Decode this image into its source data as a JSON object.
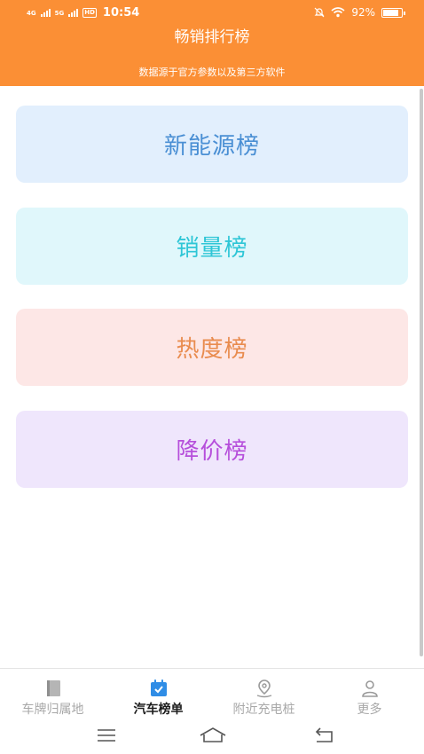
{
  "status_bar": {
    "net1": "4G",
    "net2": "5G",
    "hd": "HD",
    "time": "10:54",
    "battery_text": "92%",
    "battery_level": 0.92
  },
  "header": {
    "title": "畅销排行榜",
    "subtitle": "数据源于官方参数以及第三方软件",
    "bg_color": "#fb8f35"
  },
  "cards": [
    {
      "label": "新能源榜",
      "bg": "#e2effd",
      "color": "#4a8fd4"
    },
    {
      "label": "销量榜",
      "bg": "#e0f7fb",
      "color": "#2ec6d6"
    },
    {
      "label": "热度榜",
      "bg": "#fde7e6",
      "color": "#e98c4f"
    },
    {
      "label": "降价榜",
      "bg": "#efe6fc",
      "color": "#b64fdb"
    }
  ],
  "tabbar": {
    "tabs": [
      {
        "label": "车牌归属地",
        "icon": "book-icon",
        "active": false
      },
      {
        "label": "汽车榜单",
        "icon": "calendar-check-icon",
        "active": true
      },
      {
        "label": "附近充电桩",
        "icon": "location-pin-icon",
        "active": false
      },
      {
        "label": "更多",
        "icon": "user-icon",
        "active": false
      }
    ],
    "active_color": "#2f8de6"
  },
  "navbar": {
    "buttons": [
      "menu-icon",
      "home-icon",
      "back-icon"
    ]
  }
}
